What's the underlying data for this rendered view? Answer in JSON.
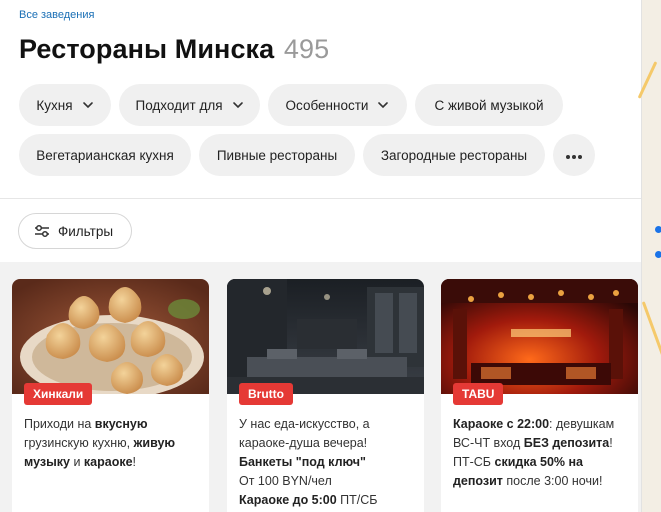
{
  "breadcrumb": "Все заведения",
  "page": {
    "title": "Рестораны Минска",
    "count": "495"
  },
  "chips_row1": [
    {
      "label": "Кухня",
      "dropdown": true
    },
    {
      "label": "Подходит для",
      "dropdown": true
    },
    {
      "label": "Особенности",
      "dropdown": true
    },
    {
      "label": "С живой музыкой",
      "dropdown": false
    }
  ],
  "chips_row2": [
    {
      "label": "Вегетарианская кухня"
    },
    {
      "label": "Пивные рестораны"
    },
    {
      "label": "Загородные рестораны"
    }
  ],
  "more_icon": "more-horizontal-icon",
  "filters": {
    "label": "Фильтры",
    "icon": "sliders-icon"
  },
  "colors": {
    "accent": "#e53935",
    "link": "#1a6fb5",
    "chip_bg": "#f0f0f0"
  },
  "cards": [
    {
      "tag": "Хинкали",
      "desc": [
        {
          "t": "Приходи на ",
          "b": false
        },
        {
          "t": "вкусную",
          "b": true
        },
        {
          "t": " грузинскую кухню, ",
          "b": false
        },
        {
          "t": "живую музыку",
          "b": true
        },
        {
          "t": " и ",
          "b": false
        },
        {
          "t": "караоке",
          "b": true
        },
        {
          "t": "!",
          "b": false
        }
      ]
    },
    {
      "tag": "Brutto",
      "desc": [
        {
          "t": "У нас еда-искусство, а караоке-душа вечера!",
          "b": false,
          "br": true
        },
        {
          "t": "Банкеты \"под ключ\"",
          "b": true,
          "br": true
        },
        {
          "t": "От 100 BYN/чел",
          "b": false,
          "br": true
        },
        {
          "t": "Караоке до 5:00",
          "b": true
        },
        {
          "t": " ПТ/СБ",
          "b": false
        }
      ]
    },
    {
      "tag": "TABU",
      "desc": [
        {
          "t": "Караоке с 22:00",
          "b": true
        },
        {
          "t": ": девушкам ВС-ЧТ вход ",
          "b": false
        },
        {
          "t": "БЕЗ депозита",
          "b": true
        },
        {
          "t": "! ПТ-СБ ",
          "b": false
        },
        {
          "t": "скидка 50% на депозит",
          "b": true
        },
        {
          "t": " после 3:00 ночи!",
          "b": false
        }
      ]
    }
  ]
}
